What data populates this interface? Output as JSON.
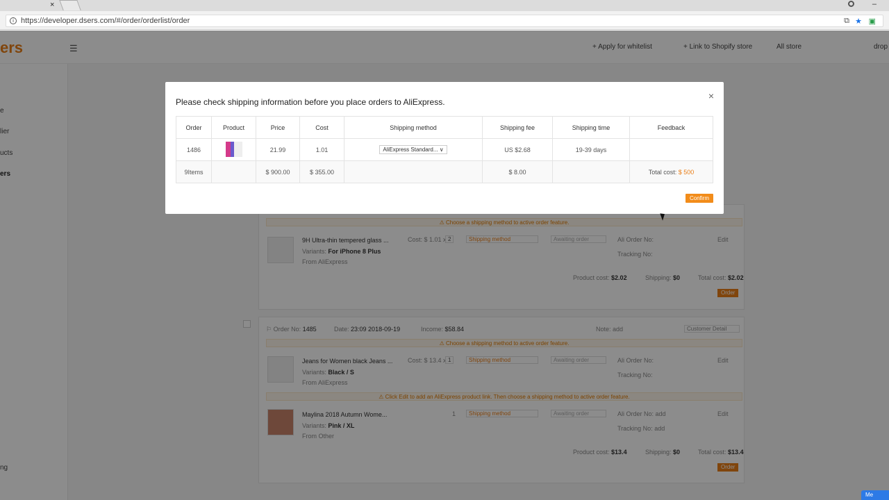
{
  "browser": {
    "url": "https://developer.dsers.com/#/order/orderlist/order",
    "tab_close": "×",
    "minimize": "–"
  },
  "app": {
    "logo": "ers",
    "header": {
      "apply_whitelist": "+ Apply for whitelist",
      "link_shopify": "+ Link to Shopify store",
      "store_select": "All store",
      "user": "drop"
    },
    "sidebar": [
      {
        "label": "e"
      },
      {
        "label": "lier"
      },
      {
        "label": "ucts"
      },
      {
        "label": "ers"
      },
      {
        "label": "ng"
      }
    ],
    "orders": [
      {
        "warning": "Choose a shipping method to active order feature.",
        "product_title": "9H Ultra-thin tempered glass ...",
        "cost": "Cost: $ 1.01 x",
        "qty": "2",
        "variants_label": "Variants:",
        "variant": "For iPhone 8 Plus",
        "from": "From AliExpress",
        "shipping_method": "Shipping method",
        "awaiting": "Awaiting order",
        "ali_order_no": "Ali Order No:",
        "tracking_no": "Tracking No:",
        "edit": "Edit",
        "product_cost": "Product cost:",
        "product_cost_val": "$2.02",
        "shipping": "Shipping:",
        "shipping_val": "$0",
        "total_cost": "Total cost:",
        "total_cost_val": "$2.02",
        "order_btn": "Order"
      },
      {
        "order_no_label": "Order No:",
        "order_no": "1485",
        "date_label": "Date:",
        "date": "23:09 2018-09-19",
        "income_label": "Income:",
        "income": "$58.84",
        "note_label": "Note:",
        "note_add": "add",
        "customer_detail": "Customer Detail",
        "warning": "Choose a shipping method to active order feature.",
        "item1_title": "Jeans for Women black Jeans ...",
        "item1_cost": "Cost: $ 13.4 x",
        "item1_qty": "1",
        "item1_variant": "Black / S",
        "item1_from": "From AliExpress",
        "warning2": "Click Edit to add an AliExpress product link. Then choose a shipping method to active order feature.",
        "item2_title": "Maylina 2018 Autumn Wome...",
        "item2_qty": "1",
        "item2_variant": "Pink / XL",
        "item2_from": "From Other",
        "add": "add",
        "product_cost_val": "$13.4",
        "shipping_val": "$0",
        "total_cost_val": "$13.4",
        "order_btn": "Order"
      }
    ]
  },
  "modal": {
    "title": "Please check shipping information before you place orders to AliExpress.",
    "close": "×",
    "columns": [
      "Order",
      "Product",
      "Price",
      "Cost",
      "Shipping method",
      "Shipping fee",
      "Shipping time",
      "Feedback"
    ],
    "row": {
      "order": "1486",
      "price": "21.99",
      "cost": "1.01",
      "shipping_method": "AliExpress Standard...",
      "shipping_fee": "US $2.68",
      "shipping_time": "19-39 days",
      "feedback": ""
    },
    "total": {
      "items": "9Items",
      "price": "$ 900.00",
      "cost": "$ 355.00",
      "shipping_fee": "$ 8.00",
      "total_label": "Total cost:",
      "total_value": "$ 500"
    },
    "confirm": "Confirm"
  },
  "chat": "Me"
}
